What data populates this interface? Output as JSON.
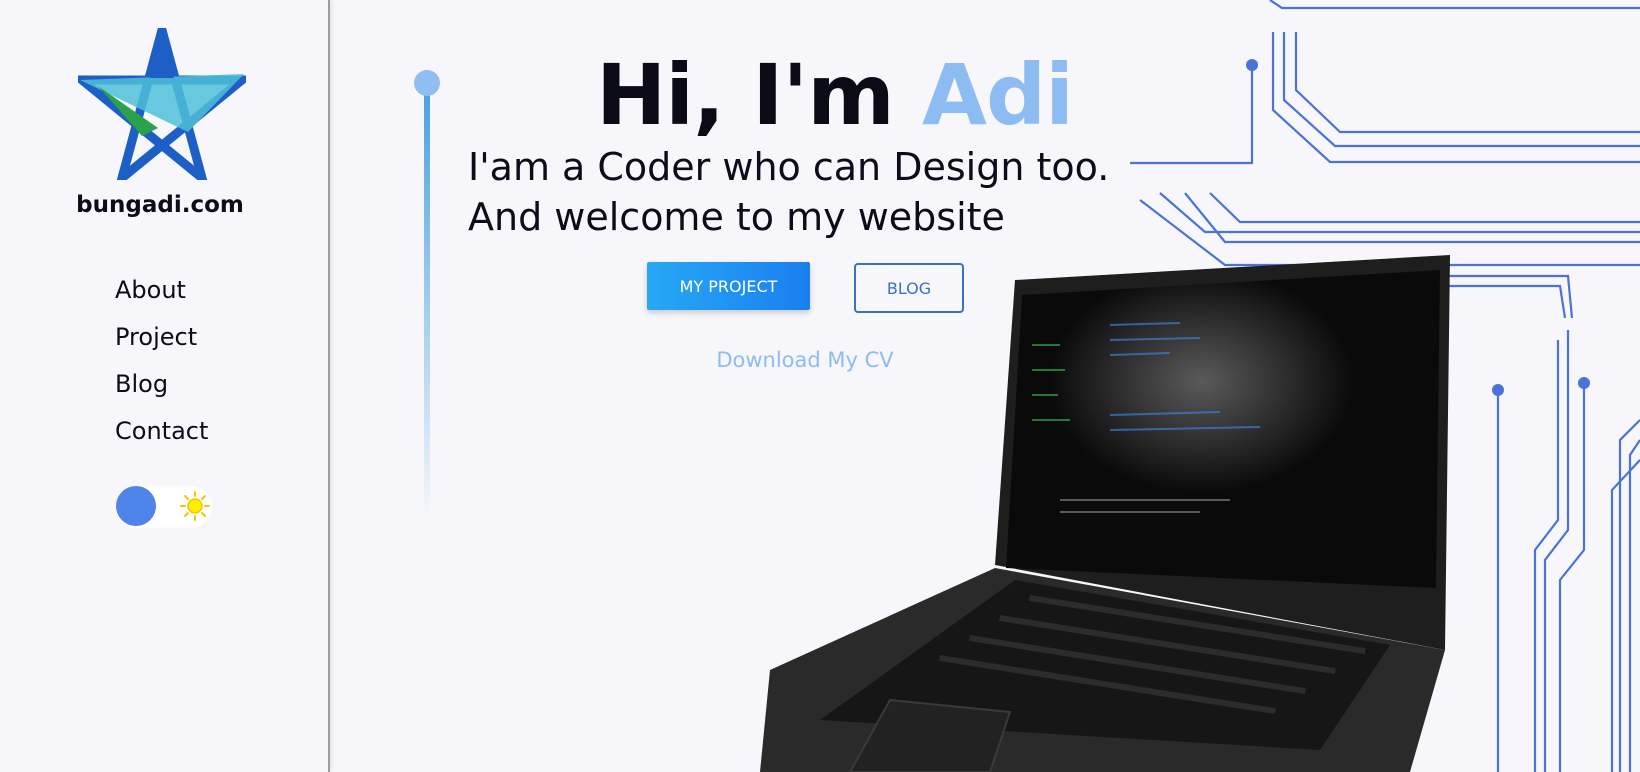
{
  "sidebar": {
    "site_name": "bungadi.com",
    "nav": [
      {
        "label": "About"
      },
      {
        "label": "Project"
      },
      {
        "label": "Blog"
      },
      {
        "label": "Contact"
      }
    ],
    "theme_toggle": {
      "mode": "light",
      "icon": "sun-icon"
    }
  },
  "hero": {
    "greeting": "Hi, I'm",
    "name": "Adi",
    "subtitle_line1": "I'am a Coder who can Design too.",
    "subtitle_line2": "And welcome to my website",
    "project_button": "MY PROJECT",
    "blog_button": "BLOG",
    "download_link": "Download My CV"
  },
  "colors": {
    "accent": "#8cbcf2",
    "primary_button": "#1a8df2",
    "circuit": "#4a72d8",
    "toggle_knob": "#4f84ea"
  }
}
